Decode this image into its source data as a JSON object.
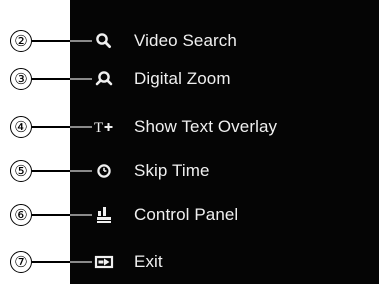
{
  "menu": {
    "items": [
      {
        "callout": "②",
        "label": "Video Search",
        "icon": "search-icon"
      },
      {
        "callout": "③",
        "label": "Digital Zoom",
        "icon": "digital-zoom-icon"
      },
      {
        "callout": "④",
        "label": "Show Text Overlay",
        "icon": "text-overlay-icon"
      },
      {
        "callout": "⑤",
        "label": "Skip Time",
        "icon": "clock-icon"
      },
      {
        "callout": "⑥",
        "label": "Control Panel",
        "icon": "control-panel-icon"
      },
      {
        "callout": "⑦",
        "label": "Exit",
        "icon": "exit-icon"
      }
    ]
  },
  "colors": {
    "menu_background": "#050505",
    "menu_text": "#f0f0f0",
    "callout_line": "#000000"
  }
}
